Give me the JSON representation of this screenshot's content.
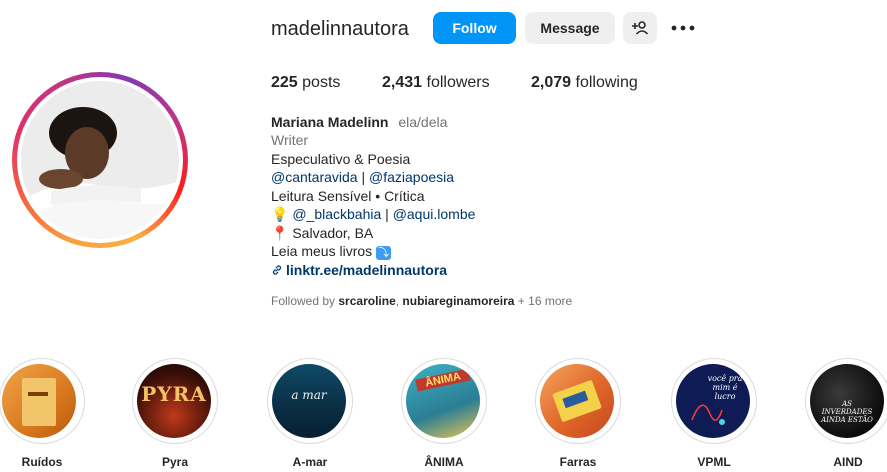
{
  "profile": {
    "username": "madelinnautora",
    "follow_label": "Follow",
    "message_label": "Message",
    "suggest_icon": "add-person-icon",
    "more_icon": "more-horizontal-icon"
  },
  "stats": {
    "posts_count": "225",
    "posts_label": "posts",
    "followers_count": "2,431",
    "followers_label": "followers",
    "following_count": "2,079",
    "following_label": "following"
  },
  "bio": {
    "name": "Mariana Madelinn",
    "pronouns": "ela/dela",
    "category": "Writer",
    "line1": "Especulativo & Poesia",
    "mention1": "@cantaravida",
    "mention_sep": "|",
    "mention2": "@faziapoesia",
    "line3": "Leitura Sensível • Crítica",
    "bulb": "💡",
    "mention3": "@_blackbahia",
    "mention4": "@aqui.lombe",
    "pin": "📍",
    "location": "Salvador, BA",
    "books": "Leia meus livros",
    "arrow": "⤵",
    "link": "linktr.ee/madelinnautora"
  },
  "followed_by": {
    "prefix": "Followed by",
    "user1": "srcaroline",
    "user2": "nubiareginamoreira",
    "more": "+ 16 more"
  },
  "highlights": [
    {
      "label": "Ruídos"
    },
    {
      "label": "Pyra",
      "cover_text": "PYRA"
    },
    {
      "label": "A-mar",
      "cover_text": "a mar"
    },
    {
      "label": "ÂNIMA",
      "cover_text": "ÂNIMA"
    },
    {
      "label": "Farras"
    },
    {
      "label": "VPML",
      "cover_text": "você pra mim é lucro"
    },
    {
      "label": "AIND",
      "cover_text": "AS INVERDADES AINDA ESTÃO"
    }
  ],
  "colors": {
    "follow_blue": "#0095f6",
    "link_blue": "#00376b",
    "button_gray": "#efefef"
  }
}
